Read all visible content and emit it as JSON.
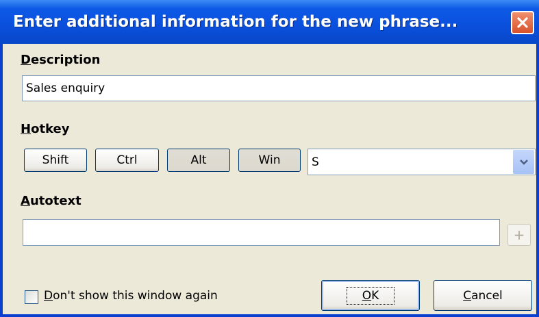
{
  "window": {
    "title": "Enter additional information for the new phrase...",
    "close_icon": "close-icon",
    "accent": "#0a4fdc"
  },
  "description": {
    "label_first": "D",
    "label_rest": "escription",
    "value": "Sales enquiry"
  },
  "hotkey": {
    "label_first": "H",
    "label_rest": "otkey",
    "modifiers": [
      {
        "label": "Shift",
        "pressed": false
      },
      {
        "label": "Ctrl",
        "pressed": false
      },
      {
        "label": "Alt",
        "pressed": true
      },
      {
        "label": "Win",
        "pressed": true
      }
    ],
    "key_value": "S"
  },
  "autotext": {
    "label_first": "A",
    "label_rest": "utotext",
    "value": "",
    "add_label": "+"
  },
  "footer": {
    "checkbox_first": "D",
    "checkbox_rest": "on't show this window again",
    "checkbox_checked": false,
    "ok_first": "O",
    "ok_rest": "K",
    "cancel_first": "C",
    "cancel_rest": "ancel"
  }
}
